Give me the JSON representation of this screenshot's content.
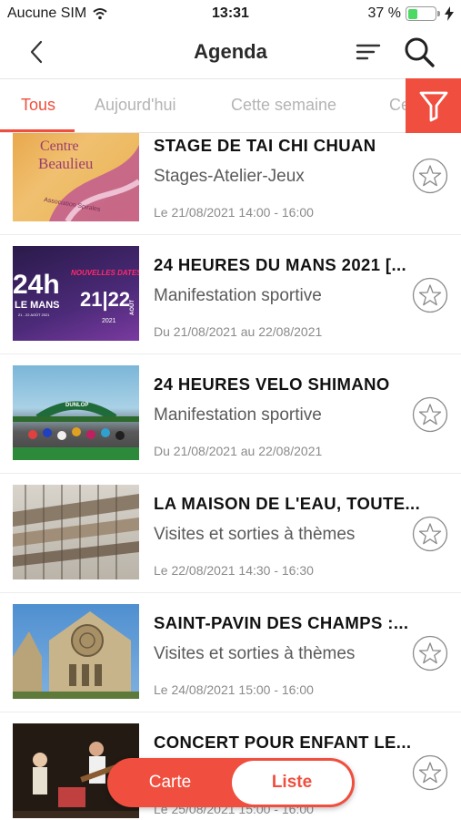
{
  "status_bar": {
    "carrier": "Aucune SIM",
    "time": "13:31",
    "battery": "37 %",
    "battery_level": 0.37,
    "wifi_icon": "wifi-icon",
    "charging_icon": "bolt-icon"
  },
  "header": {
    "title": "Agenda",
    "back_icon": "chevron-left-icon",
    "sort_icon": "sort-lines-icon",
    "search_icon": "search-icon"
  },
  "tabs": [
    {
      "label": "Tous",
      "active": true
    },
    {
      "label": "Aujourd'hui",
      "active": false
    },
    {
      "label": "Cette semaine",
      "active": false
    },
    {
      "label": "Ce",
      "active": false
    }
  ],
  "filter_icon": "funnel-icon",
  "accent_color": "#f04e3e",
  "events": [
    {
      "title": "STAGE DE TAI CHI CHUAN",
      "category": "Stages-Atelier-Jeux",
      "date": "Le 21/08/2021 14:00 - 16:00",
      "thumb_text_1": "Centre",
      "thumb_text_2": "Beaulieu",
      "thumb_text_3": "Association Spirales"
    },
    {
      "title": "24 HEURES DU MANS 2021 [...",
      "category": "Manifestation sportive",
      "date": "Du 21/08/2021 au 22/08/2021",
      "thumb_text_1": "24h",
      "thumb_text_2": "LE MANS",
      "thumb_text_3": "NOUVELLES DATES",
      "thumb_text_4": "21|22",
      "thumb_text_5": "AOÛT",
      "thumb_text_6": "2021",
      "thumb_text_7": "21 - 22 AOÛT 2021"
    },
    {
      "title": "24 HEURES VELO SHIMANO",
      "category": "Manifestation sportive",
      "date": "Du 21/08/2021 au 22/08/2021",
      "thumb_text_1": "DUNLOP"
    },
    {
      "title": "LA MAISON DE L'EAU, TOUTE...",
      "category": "Visites et sorties à thèmes",
      "date": "Le 22/08/2021 14:30 - 16:30"
    },
    {
      "title": "SAINT-PAVIN DES CHAMPS :...",
      "category": "Visites et sorties à thèmes",
      "date": "Le 24/08/2021 15:00 - 16:00"
    },
    {
      "title": "CONCERT POUR ENFANT LE...",
      "category": "",
      "date": "Le 25/08/2021 15:00 - 16:00"
    }
  ],
  "favorite_icon": "star-outline-icon",
  "view_toggle": {
    "map_label": "Carte",
    "list_label": "Liste",
    "selected": "Liste"
  }
}
